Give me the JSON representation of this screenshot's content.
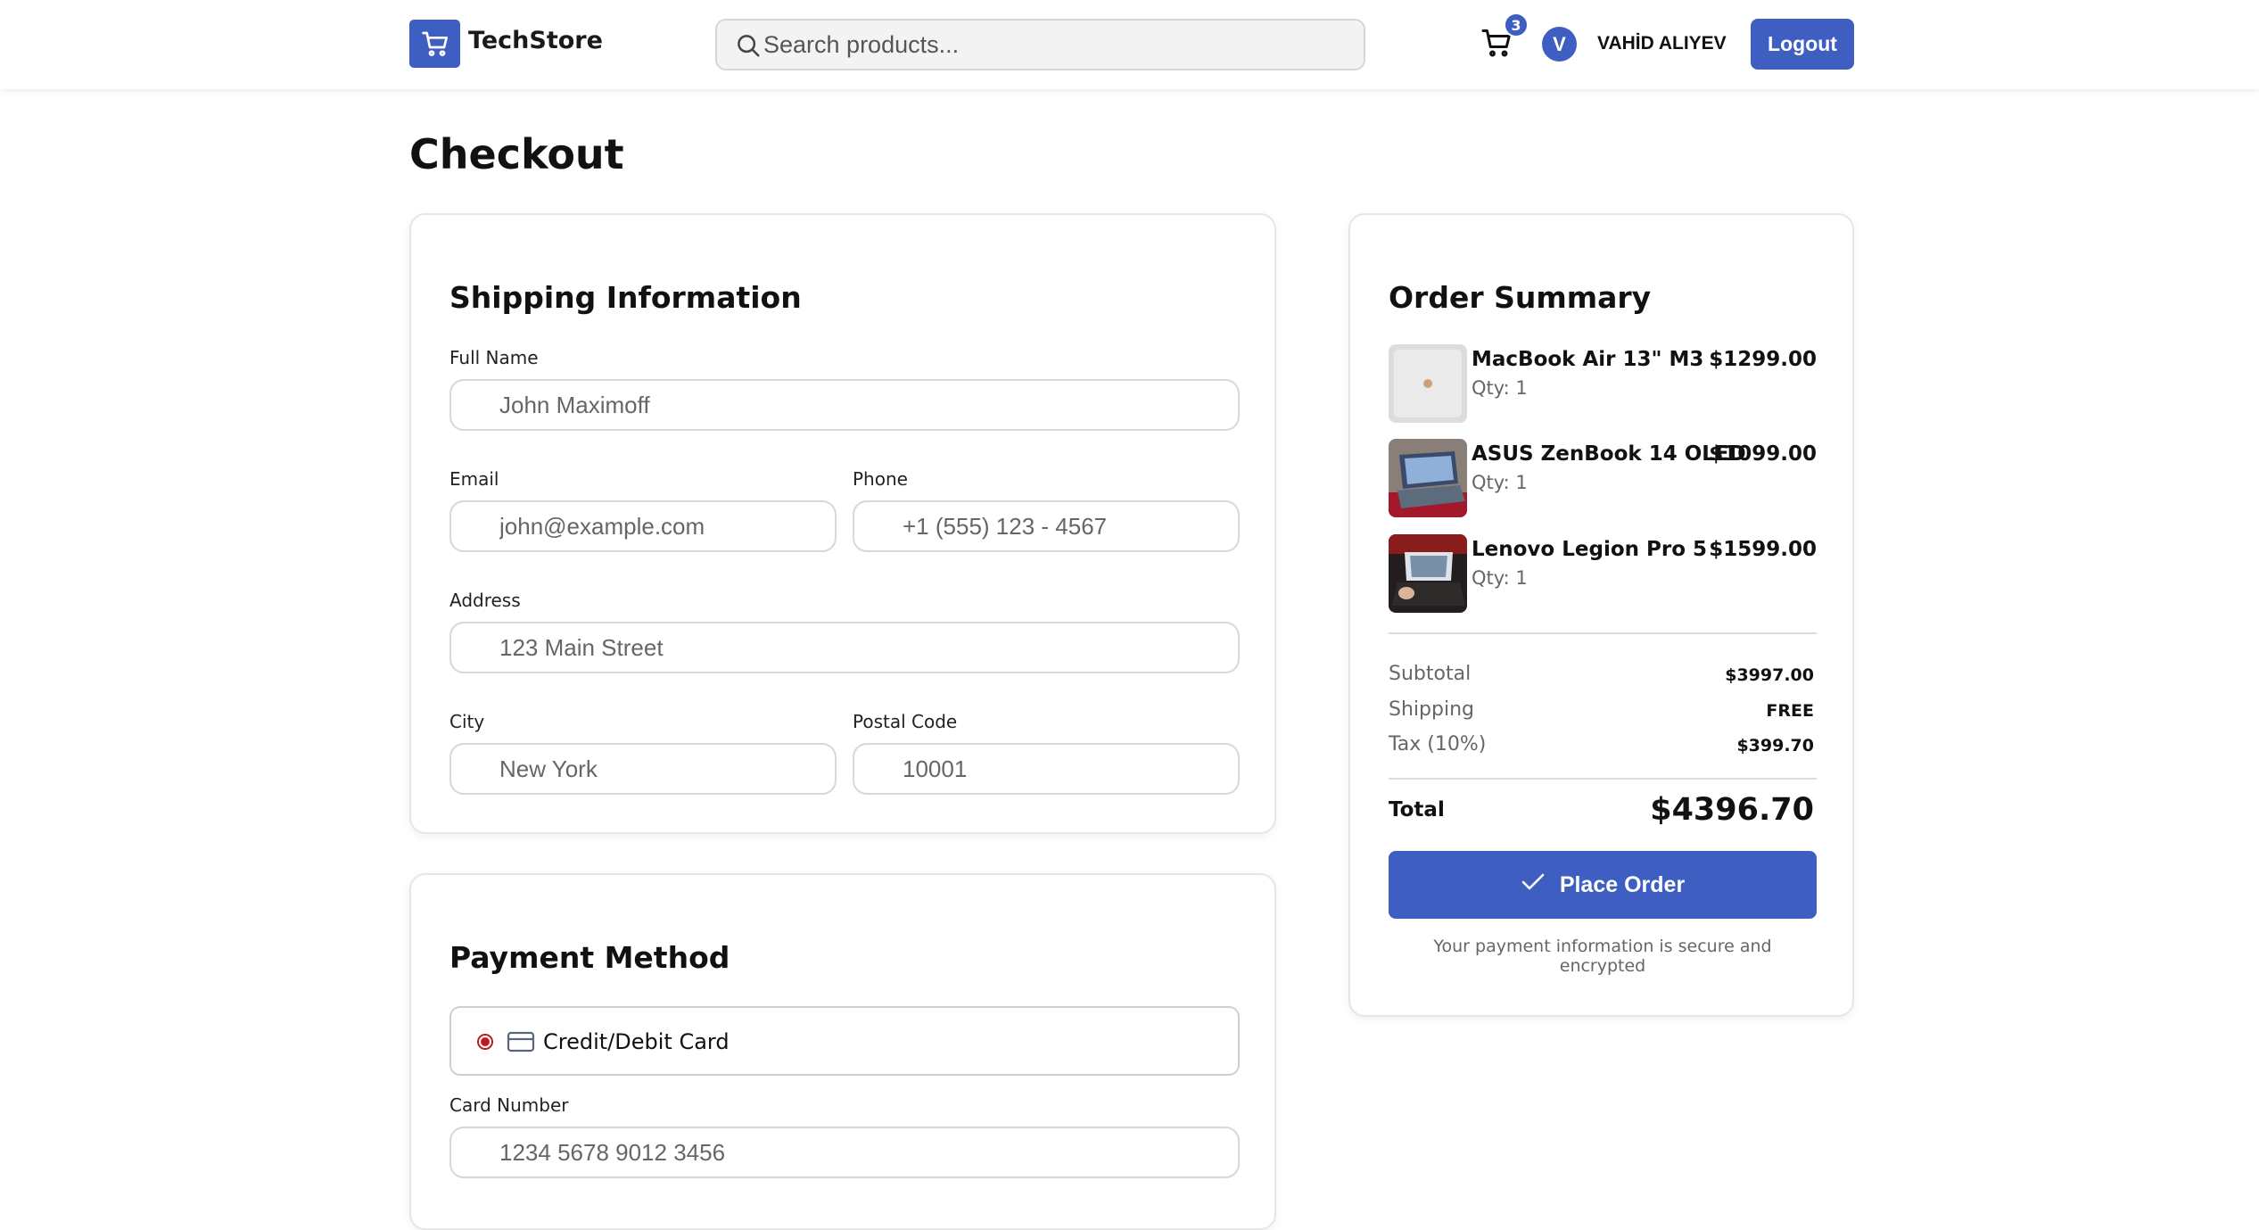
{
  "header": {
    "brand": "TechStore",
    "search_placeholder": "Search products...",
    "cart_count": "3",
    "avatar_initial": "V",
    "user_name": "VAHİD ALIYEV",
    "logout_label": "Logout"
  },
  "page": {
    "title": "Checkout"
  },
  "shipping": {
    "title": "Shipping Information",
    "full_name": {
      "label": "Full Name",
      "placeholder": "John Maximoff"
    },
    "email": {
      "label": "Email",
      "placeholder": "john@example.com"
    },
    "phone": {
      "label": "Phone",
      "placeholder": "+1 (555) 123 - 4567"
    },
    "address": {
      "label": "Address",
      "placeholder": "123 Main Street"
    },
    "city": {
      "label": "City",
      "placeholder": "New York"
    },
    "postal": {
      "label": "Postal Code",
      "placeholder": "10001"
    }
  },
  "payment": {
    "title": "Payment Method",
    "option_label": "Credit/Debit Card",
    "card_number": {
      "label": "Card Number",
      "placeholder": "1234 5678 9012 3456"
    }
  },
  "summary": {
    "title": "Order Summary",
    "items": [
      {
        "name": "MacBook Air 13\" M3",
        "qty": "Qty: 1",
        "price": "$1299.00"
      },
      {
        "name": "ASUS ZenBook 14 OLED",
        "qty": "Qty: 1",
        "price": "$1099.00"
      },
      {
        "name": "Lenovo Legion Pro 5",
        "qty": "Qty: 1",
        "price": "$1599.00"
      }
    ],
    "subtotal_label": "Subtotal",
    "subtotal_value": "$3997.00",
    "shipping_label": "Shipping",
    "shipping_value": "FREE",
    "tax_label": "Tax (10%)",
    "tax_value": "$399.70",
    "total_label": "Total",
    "total_value": "$4396.70",
    "place_order_label": "Place Order",
    "secure_note": "Your payment information is secure and encrypted"
  },
  "colors": {
    "accent": "#3f5ec2",
    "radio_selected": "#c21a1a"
  },
  "icons": {
    "logo": "shopping-cart-icon",
    "search": "search-icon",
    "cart": "cart-icon",
    "card": "credit-card-icon",
    "check": "check-icon"
  }
}
